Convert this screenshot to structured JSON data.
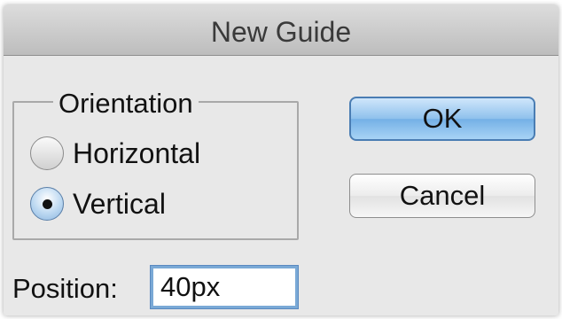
{
  "dialog": {
    "title": "New Guide"
  },
  "orientation": {
    "legend": "Orientation",
    "options": [
      {
        "label": "Horizontal",
        "checked": false
      },
      {
        "label": "Vertical",
        "checked": true
      }
    ]
  },
  "buttons": {
    "ok_label": "OK",
    "cancel_label": "Cancel"
  },
  "position": {
    "label": "Position:",
    "value": "40px"
  },
  "colors": {
    "default_button": "#8fc1ec",
    "focus_ring": "#7aa9d6"
  }
}
